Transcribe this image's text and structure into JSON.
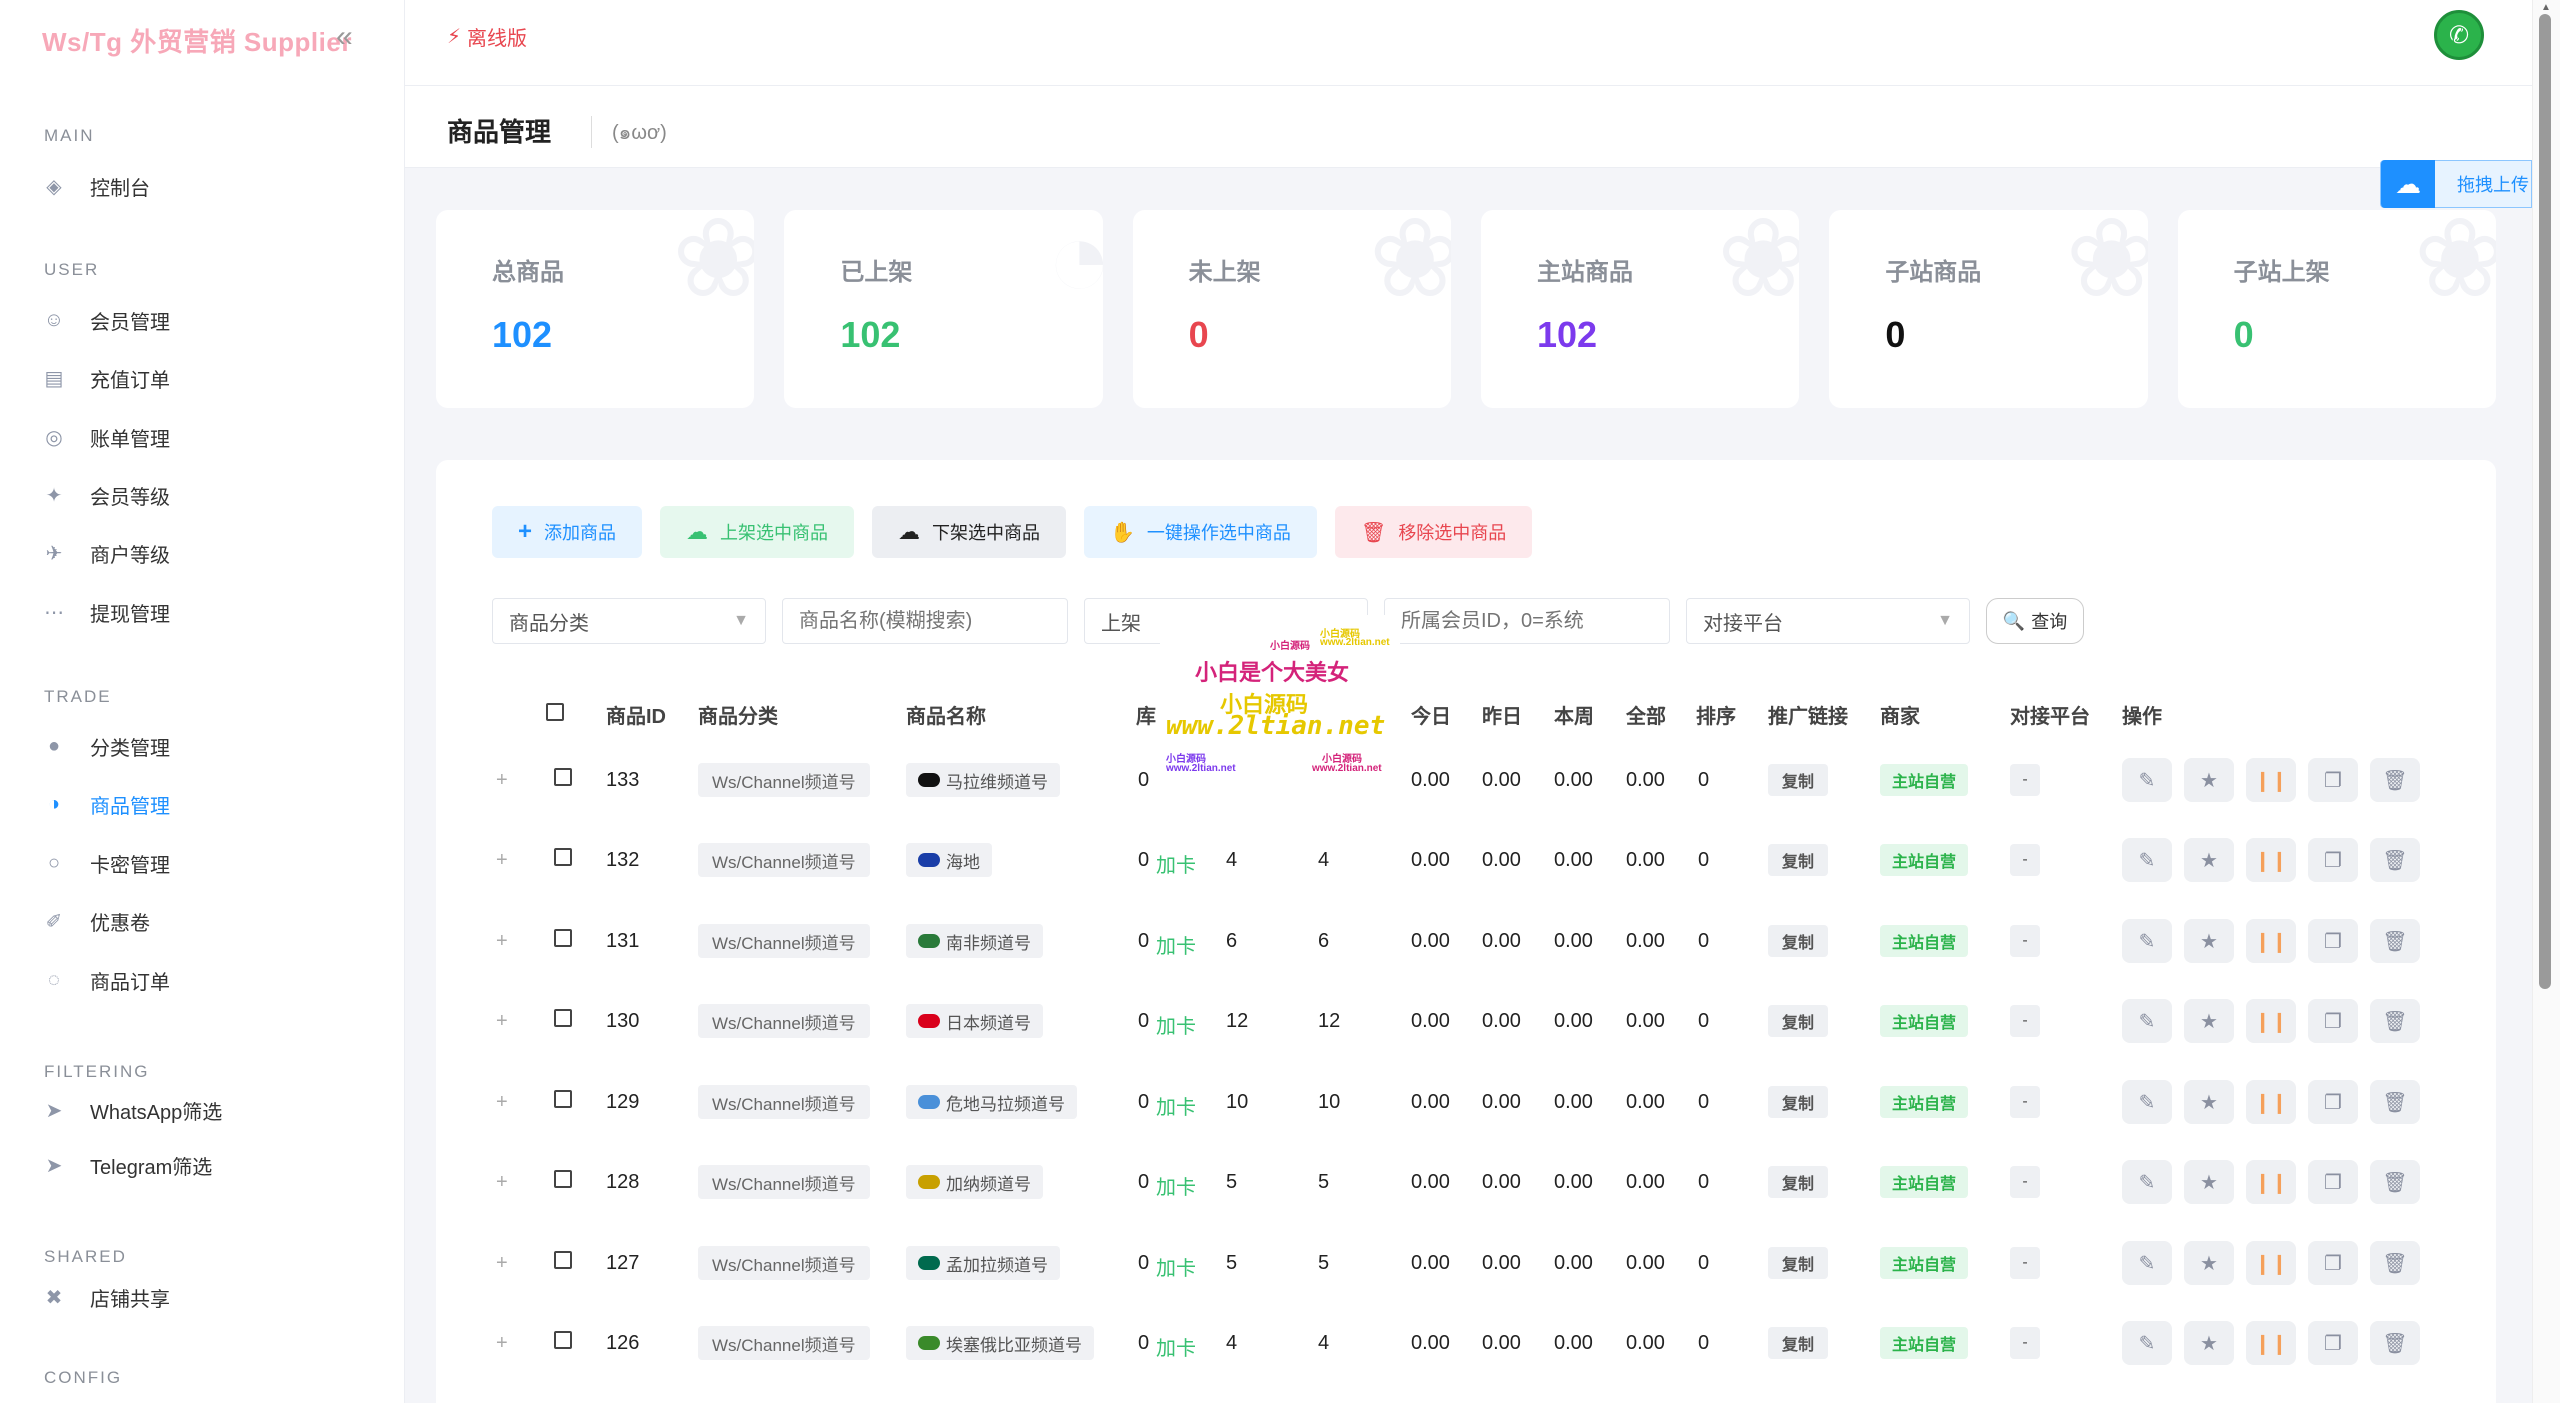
{
  "brand": {
    "title": "Ws/Tg 外贸营销 Supplier"
  },
  "sidebar": {
    "sections": [
      {
        "label": "MAIN",
        "items": [
          {
            "label": "控制台",
            "icon": "dashboard-icon"
          }
        ]
      },
      {
        "label": "USER",
        "items": [
          {
            "label": "会员管理",
            "icon": "user-icon"
          },
          {
            "label": "充值订单",
            "icon": "recharge-icon"
          },
          {
            "label": "账单管理",
            "icon": "bill-icon"
          },
          {
            "label": "会员等级",
            "icon": "level-icon"
          },
          {
            "label": "商户等级",
            "icon": "merchant-icon"
          },
          {
            "label": "提现管理",
            "icon": "withdraw-icon"
          }
        ]
      },
      {
        "label": "TRADE",
        "items": [
          {
            "label": "分类管理",
            "icon": "category-icon"
          },
          {
            "label": "商品管理",
            "icon": "goods-icon",
            "active": true
          },
          {
            "label": "卡密管理",
            "icon": "card-icon"
          },
          {
            "label": "优惠卷",
            "icon": "coupon-icon"
          },
          {
            "label": "商品订单",
            "icon": "order-icon"
          }
        ]
      },
      {
        "label": "FILTERING",
        "items": [
          {
            "label": "WhatsApp筛选",
            "icon": "send-icon"
          },
          {
            "label": "Telegram筛选",
            "icon": "send-icon"
          }
        ]
      },
      {
        "label": "SHARED",
        "items": [
          {
            "label": "店铺共享",
            "icon": "share-icon"
          }
        ]
      },
      {
        "label": "CONFIG",
        "items": []
      }
    ]
  },
  "topbar": {
    "offline": "离线版"
  },
  "page": {
    "title": "商品管理",
    "emote": "(๑ωơ)"
  },
  "upload": {
    "label": "拖拽上传"
  },
  "stats": [
    {
      "label": "总商品",
      "value": "102",
      "color": "#1e90ff"
    },
    {
      "label": "已上架",
      "value": "102",
      "color": "#38c172"
    },
    {
      "label": "未上架",
      "value": "0",
      "color": "#e8464f"
    },
    {
      "label": "主站商品",
      "value": "102",
      "color": "#7c3aed"
    },
    {
      "label": "子站商品",
      "value": "0",
      "color": "#111111"
    },
    {
      "label": "子站上架",
      "value": "0",
      "color": "#38c172"
    }
  ],
  "toolbar": {
    "add": "添加商品",
    "shelve": "上架选中商品",
    "unshelve": "下架选中商品",
    "batch": "一键操作选中商品",
    "remove": "移除选中商品"
  },
  "filters": {
    "category": "商品分类",
    "name_placeholder": "商品名称(模糊搜索)",
    "status": "上架",
    "member_placeholder": "所属会员ID，0=系统",
    "platform": "对接平台",
    "query": "查询"
  },
  "table": {
    "headers": [
      "商品ID",
      "商品分类",
      "商品名称",
      "库",
      "今日",
      "昨日",
      "本周",
      "全部",
      "排序",
      "推广链接",
      "商家",
      "对接平台",
      "操作"
    ],
    "rows": [
      {
        "id": "133",
        "category": "Ws/Channel频道号",
        "name": "马拉维频道号",
        "flag": "#111111",
        "stock": "0",
        "stock_label": "",
        "a": "",
        "b": "",
        "today": "0.00",
        "yesterday": "0.00",
        "week": "0.00",
        "all": "0.00",
        "sort": "0",
        "link": "复制",
        "merchant": "主站自营",
        "platform": "-"
      },
      {
        "id": "132",
        "category": "Ws/Channel频道号",
        "name": "海地",
        "flag": "#1a3ea8",
        "stock": "0",
        "stock_label": "加卡",
        "a": "4",
        "b": "4",
        "today": "0.00",
        "yesterday": "0.00",
        "week": "0.00",
        "all": "0.00",
        "sort": "0",
        "link": "复制",
        "merchant": "主站自营",
        "platform": "-"
      },
      {
        "id": "131",
        "category": "Ws/Channel频道号",
        "name": "南非频道号",
        "flag": "#2a7a3a",
        "stock": "0",
        "stock_label": "加卡",
        "a": "6",
        "b": "6",
        "today": "0.00",
        "yesterday": "0.00",
        "week": "0.00",
        "all": "0.00",
        "sort": "0",
        "link": "复制",
        "merchant": "主站自营",
        "platform": "-"
      },
      {
        "id": "130",
        "category": "Ws/Channel频道号",
        "name": "日本频道号",
        "flag": "#d9001b",
        "stock": "0",
        "stock_label": "加卡",
        "a": "12",
        "b": "12",
        "today": "0.00",
        "yesterday": "0.00",
        "week": "0.00",
        "all": "0.00",
        "sort": "0",
        "link": "复制",
        "merchant": "主站自营",
        "platform": "-"
      },
      {
        "id": "129",
        "category": "Ws/Channel频道号",
        "name": "危地马拉频道号",
        "flag": "#4a90d9",
        "stock": "0",
        "stock_label": "加卡",
        "a": "10",
        "b": "10",
        "today": "0.00",
        "yesterday": "0.00",
        "week": "0.00",
        "all": "0.00",
        "sort": "0",
        "link": "复制",
        "merchant": "主站自营",
        "platform": "-"
      },
      {
        "id": "128",
        "category": "Ws/Channel频道号",
        "name": "加纳频道号",
        "flag": "#c8a000",
        "stock": "0",
        "stock_label": "加卡",
        "a": "5",
        "b": "5",
        "today": "0.00",
        "yesterday": "0.00",
        "week": "0.00",
        "all": "0.00",
        "sort": "0",
        "link": "复制",
        "merchant": "主站自营",
        "platform": "-"
      },
      {
        "id": "127",
        "category": "Ws/Channel频道号",
        "name": "孟加拉频道号",
        "flag": "#006a4e",
        "stock": "0",
        "stock_label": "加卡",
        "a": "5",
        "b": "5",
        "today": "0.00",
        "yesterday": "0.00",
        "week": "0.00",
        "all": "0.00",
        "sort": "0",
        "link": "复制",
        "merchant": "主站自营",
        "platform": "-"
      },
      {
        "id": "126",
        "category": "Ws/Channel频道号",
        "name": "埃塞俄比亚频道号",
        "flag": "#3a8a2a",
        "stock": "0",
        "stock_label": "加卡",
        "a": "4",
        "b": "4",
        "today": "0.00",
        "yesterday": "0.00",
        "week": "0.00",
        "all": "0.00",
        "sort": "0",
        "link": "复制",
        "merchant": "主站自营",
        "platform": "-"
      }
    ]
  },
  "watermark": {
    "line1": "小白是个大美女",
    "line2": "小白源码",
    "line3": "www.2ltian.net",
    "small": "www.2ltian.net"
  }
}
